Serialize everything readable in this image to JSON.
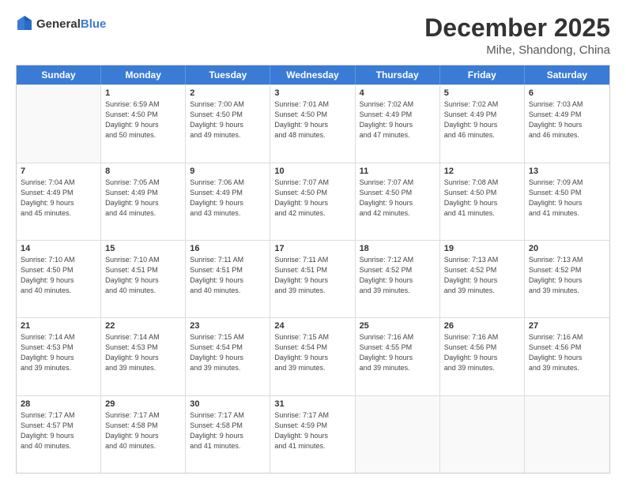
{
  "header": {
    "logo_general": "General",
    "logo_blue": "Blue",
    "month": "December 2025",
    "location": "Mihe, Shandong, China"
  },
  "weekdays": [
    "Sunday",
    "Monday",
    "Tuesday",
    "Wednesday",
    "Thursday",
    "Friday",
    "Saturday"
  ],
  "weeks": [
    [
      {
        "day": "",
        "info": "",
        "empty": true
      },
      {
        "day": "1",
        "info": "Sunrise: 6:59 AM\nSunset: 4:50 PM\nDaylight: 9 hours\nand 50 minutes."
      },
      {
        "day": "2",
        "info": "Sunrise: 7:00 AM\nSunset: 4:50 PM\nDaylight: 9 hours\nand 49 minutes."
      },
      {
        "day": "3",
        "info": "Sunrise: 7:01 AM\nSunset: 4:50 PM\nDaylight: 9 hours\nand 48 minutes."
      },
      {
        "day": "4",
        "info": "Sunrise: 7:02 AM\nSunset: 4:49 PM\nDaylight: 9 hours\nand 47 minutes."
      },
      {
        "day": "5",
        "info": "Sunrise: 7:02 AM\nSunset: 4:49 PM\nDaylight: 9 hours\nand 46 minutes."
      },
      {
        "day": "6",
        "info": "Sunrise: 7:03 AM\nSunset: 4:49 PM\nDaylight: 9 hours\nand 46 minutes."
      }
    ],
    [
      {
        "day": "7",
        "info": "Sunrise: 7:04 AM\nSunset: 4:49 PM\nDaylight: 9 hours\nand 45 minutes."
      },
      {
        "day": "8",
        "info": "Sunrise: 7:05 AM\nSunset: 4:49 PM\nDaylight: 9 hours\nand 44 minutes."
      },
      {
        "day": "9",
        "info": "Sunrise: 7:06 AM\nSunset: 4:49 PM\nDaylight: 9 hours\nand 43 minutes."
      },
      {
        "day": "10",
        "info": "Sunrise: 7:07 AM\nSunset: 4:50 PM\nDaylight: 9 hours\nand 42 minutes."
      },
      {
        "day": "11",
        "info": "Sunrise: 7:07 AM\nSunset: 4:50 PM\nDaylight: 9 hours\nand 42 minutes."
      },
      {
        "day": "12",
        "info": "Sunrise: 7:08 AM\nSunset: 4:50 PM\nDaylight: 9 hours\nand 41 minutes."
      },
      {
        "day": "13",
        "info": "Sunrise: 7:09 AM\nSunset: 4:50 PM\nDaylight: 9 hours\nand 41 minutes."
      }
    ],
    [
      {
        "day": "14",
        "info": "Sunrise: 7:10 AM\nSunset: 4:50 PM\nDaylight: 9 hours\nand 40 minutes."
      },
      {
        "day": "15",
        "info": "Sunrise: 7:10 AM\nSunset: 4:51 PM\nDaylight: 9 hours\nand 40 minutes."
      },
      {
        "day": "16",
        "info": "Sunrise: 7:11 AM\nSunset: 4:51 PM\nDaylight: 9 hours\nand 40 minutes."
      },
      {
        "day": "17",
        "info": "Sunrise: 7:11 AM\nSunset: 4:51 PM\nDaylight: 9 hours\nand 39 minutes."
      },
      {
        "day": "18",
        "info": "Sunrise: 7:12 AM\nSunset: 4:52 PM\nDaylight: 9 hours\nand 39 minutes."
      },
      {
        "day": "19",
        "info": "Sunrise: 7:13 AM\nSunset: 4:52 PM\nDaylight: 9 hours\nand 39 minutes."
      },
      {
        "day": "20",
        "info": "Sunrise: 7:13 AM\nSunset: 4:52 PM\nDaylight: 9 hours\nand 39 minutes."
      }
    ],
    [
      {
        "day": "21",
        "info": "Sunrise: 7:14 AM\nSunset: 4:53 PM\nDaylight: 9 hours\nand 39 minutes."
      },
      {
        "day": "22",
        "info": "Sunrise: 7:14 AM\nSunset: 4:53 PM\nDaylight: 9 hours\nand 39 minutes."
      },
      {
        "day": "23",
        "info": "Sunrise: 7:15 AM\nSunset: 4:54 PM\nDaylight: 9 hours\nand 39 minutes."
      },
      {
        "day": "24",
        "info": "Sunrise: 7:15 AM\nSunset: 4:54 PM\nDaylight: 9 hours\nand 39 minutes."
      },
      {
        "day": "25",
        "info": "Sunrise: 7:16 AM\nSunset: 4:55 PM\nDaylight: 9 hours\nand 39 minutes."
      },
      {
        "day": "26",
        "info": "Sunrise: 7:16 AM\nSunset: 4:56 PM\nDaylight: 9 hours\nand 39 minutes."
      },
      {
        "day": "27",
        "info": "Sunrise: 7:16 AM\nSunset: 4:56 PM\nDaylight: 9 hours\nand 39 minutes."
      }
    ],
    [
      {
        "day": "28",
        "info": "Sunrise: 7:17 AM\nSunset: 4:57 PM\nDaylight: 9 hours\nand 40 minutes."
      },
      {
        "day": "29",
        "info": "Sunrise: 7:17 AM\nSunset: 4:58 PM\nDaylight: 9 hours\nand 40 minutes."
      },
      {
        "day": "30",
        "info": "Sunrise: 7:17 AM\nSunset: 4:58 PM\nDaylight: 9 hours\nand 41 minutes."
      },
      {
        "day": "31",
        "info": "Sunrise: 7:17 AM\nSunset: 4:59 PM\nDaylight: 9 hours\nand 41 minutes."
      },
      {
        "day": "",
        "info": "",
        "empty": true
      },
      {
        "day": "",
        "info": "",
        "empty": true
      },
      {
        "day": "",
        "info": "",
        "empty": true
      }
    ]
  ]
}
